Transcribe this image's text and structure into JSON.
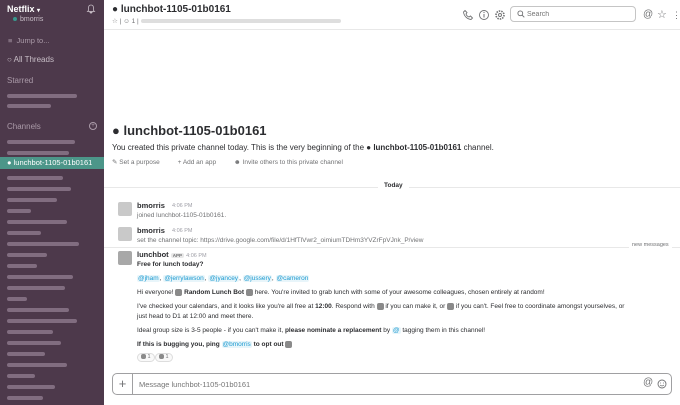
{
  "sidebar": {
    "workspace": "Netflix",
    "user": "bmorris",
    "jump_to": "Jump to...",
    "all_threads": "All Threads",
    "starred_title": "Starred",
    "channels_title": "Channels",
    "active_channel": "lunchbot-1105-01b0161"
  },
  "header": {
    "channel_name": "lunchbot-1105-01b0161",
    "member_count": "1",
    "search_placeholder": "Search"
  },
  "intro": {
    "title": "lunchbot-1105-01b0161",
    "text_before": "You created this private channel today. This is the very beginning of the",
    "channel_ref": "lunchbot-1105-01b0161",
    "text_after": "channel.",
    "set_purpose": "Set a purpose",
    "add_app": "Add an app",
    "invite": "Invite others to this private channel"
  },
  "day_label": "Today",
  "new_messages_label": "new messages",
  "messages": [
    {
      "name": "bmorris",
      "time": "4:06 PM",
      "text": "joined lunchbot-1105-01b0161."
    },
    {
      "name": "bmorris",
      "time": "4:06 PM",
      "text": "set the channel topic: https://drive.google.com/file/d/1HfTlVwr2_oimiumTDHm3YVZrFpVJnk_P/view"
    }
  ],
  "bot": {
    "name": "lunchbot",
    "badge": "APP",
    "time": "4:06 PM",
    "line1": "Free for lunch today?",
    "mentions": [
      "@jham",
      "@jerrylawson",
      "@jyancey",
      "@jussery",
      "@cameron"
    ],
    "line3_a": "Hi everyone!",
    "line3_b": "Random Lunch Bot",
    "line3_c": "here. You're invited to grab lunch with some of your awesome colleagues, chosen entirely at random!",
    "line4_a": "I've checked your calendars, and it looks like you're all free at",
    "line4_time": "12:00",
    "line4_b": ". Respond with",
    "line4_c": "if you can make it, or",
    "line4_d": "if you can't. Feel free to coordinate amongst yourselves, or",
    "line5": "just head to D1 at 12:00 and meet there.",
    "line6_a": "Ideal group size is 3-5 people - if you can't make it,",
    "line6_b": "please nominate a replacement",
    "line6_c": "by",
    "line6_d": "tagging them in this channel!",
    "line7_a": "If this is bugging you, ping",
    "line7_mention": "@bmorris",
    "line7_b": "to opt out",
    "reaction_up": "1",
    "reaction_down": "1"
  },
  "composer": {
    "placeholder": "Message lunchbot-1105-01b0161"
  }
}
